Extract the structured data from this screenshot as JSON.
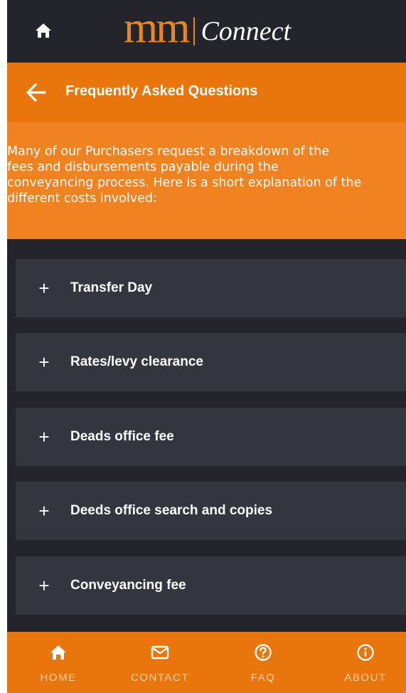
{
  "header": {
    "logo_mark": "mm",
    "logo_text": "Connect"
  },
  "titlebar": {
    "title": "Frequently Asked Questions"
  },
  "intro": {
    "text": "Many of our Purchasers request a breakdown of the\nfees and disbursements payable during the\nconveyancing process. Here is a short explanation of the\ndifferent costs involved:"
  },
  "faq": {
    "items": [
      {
        "label": "Transfer Day",
        "icon": "plus-icon"
      },
      {
        "label": "Rates/levy clearance",
        "icon": "plus-icon"
      },
      {
        "label": "Deads office fee",
        "icon": "plus-icon"
      },
      {
        "label": "Deeds office search and copies",
        "icon": "plus-icon"
      },
      {
        "label": "Conveyancing fee",
        "icon": "plus-icon"
      }
    ]
  },
  "nav": {
    "items": [
      {
        "label": "HOME",
        "icon": "home-icon"
      },
      {
        "label": "CONTACT",
        "icon": "envelope-icon"
      },
      {
        "label": "FAQ",
        "icon": "question-circle-icon"
      },
      {
        "label": "ABOUT",
        "icon": "info-circle-icon"
      }
    ]
  },
  "colors": {
    "brand_orange": "#e8760c",
    "intro_orange": "#f08220",
    "dark_bg": "#24252c",
    "card_bg": "#33353f",
    "logo_orange": "#e9871f"
  }
}
